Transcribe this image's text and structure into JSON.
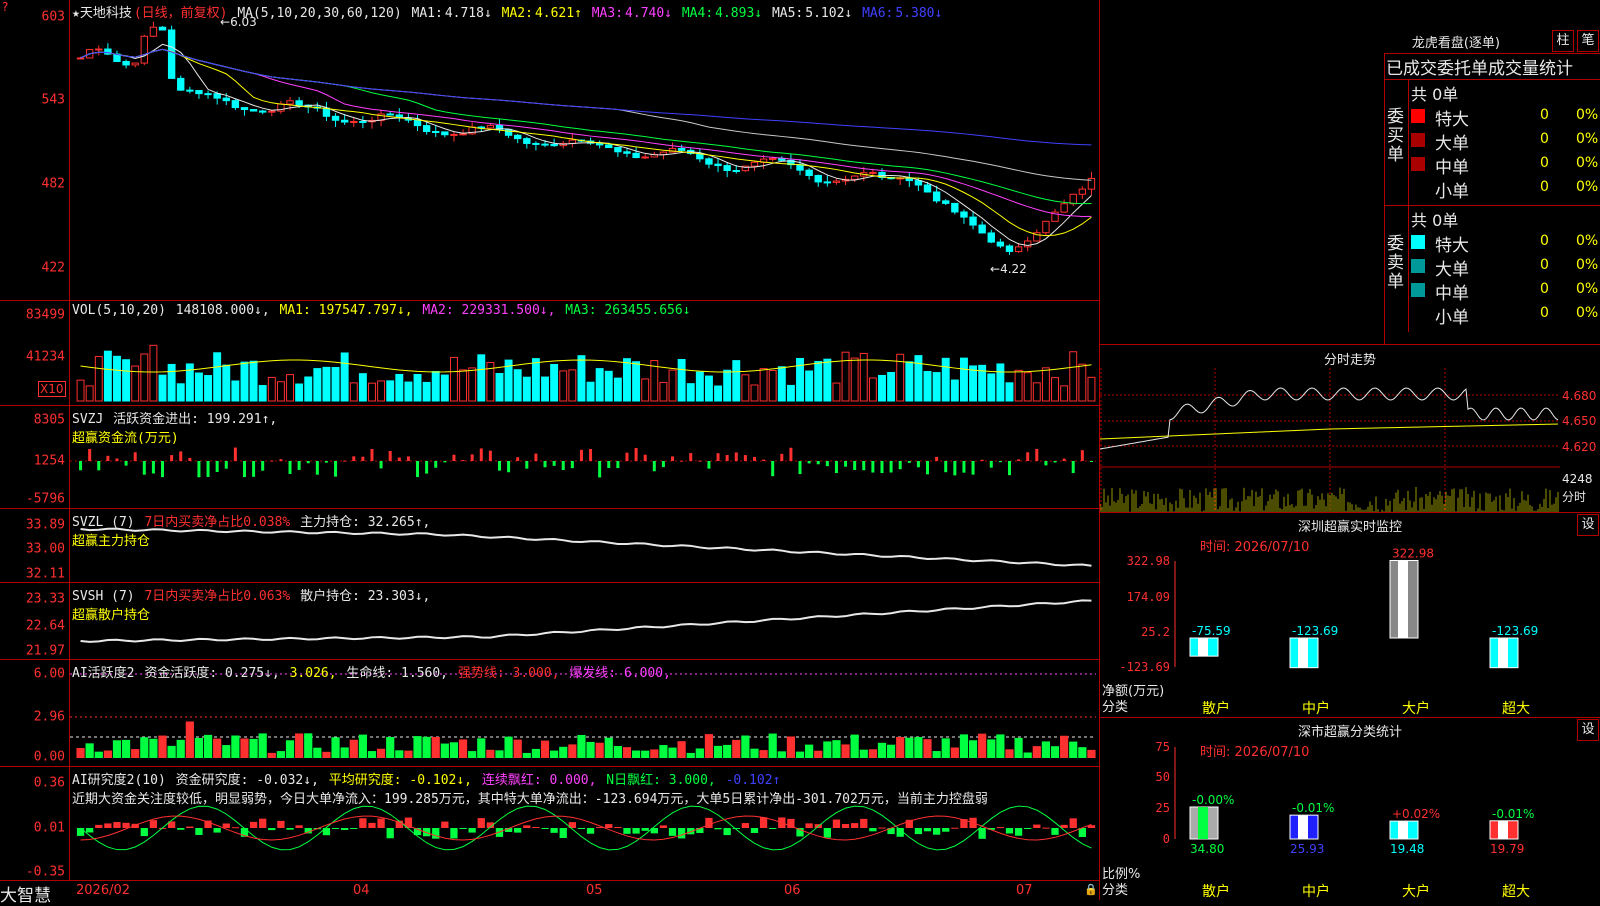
{
  "app": {
    "brand": "大智慧"
  },
  "main": {
    "stock_name": "★天地科技",
    "period": "(日线，前复权)",
    "ma_title": "MA(5,10,20,30,60,120)",
    "ma": [
      {
        "label": "MA1:",
        "value": "4.718↓",
        "color": "#e8e8e8"
      },
      {
        "label": "MA2:",
        "value": "4.621↑",
        "color": "#ffff00"
      },
      {
        "label": "MA3:",
        "value": "4.740↓",
        "color": "#ff40ff"
      },
      {
        "label": "MA4:",
        "value": "4.893↓",
        "color": "#00ff40"
      },
      {
        "label": "MA5:",
        "value": "5.102↓",
        "color": "#e8e8e8"
      },
      {
        "label": "MA6:",
        "value": "5.380↓",
        "color": "#4040ff"
      }
    ],
    "y_labels": [
      "603",
      "543",
      "482",
      "422"
    ],
    "high_marker": "6.03",
    "low_marker": "4.22"
  },
  "vol": {
    "title": "VOL(5,10,20)",
    "value": "148108.000↓,",
    "ma1": "MA1: 197547.797↓,",
    "ma2": "MA2: 229331.500↓,",
    "ma3": "MA3: 263455.656↓",
    "y_labels": [
      "83499",
      "41234"
    ],
    "unit": "X10"
  },
  "svzj": {
    "title": "SVZJ",
    "line1": "活跃资金进出: 199.291↑,",
    "line2": "超赢资金流(万元)",
    "y_labels": [
      "8305",
      "1254",
      "-5796"
    ]
  },
  "svzl": {
    "title": "SVZL (7)",
    "ratio": "7日内买卖净占比0.038%",
    "hold": "主力持仓: 32.265↑,",
    "line2": "超赢主力持仓",
    "y_labels": [
      "33.89",
      "33.00",
      "32.11"
    ]
  },
  "svsh": {
    "title": "SVSH (7)",
    "ratio": "7日内买卖净占比0.063%",
    "hold": "散户持仓: 23.303↓,",
    "line2": "超赢散户持仓",
    "y_labels": [
      "23.33",
      "22.64",
      "21.97"
    ]
  },
  "ai1": {
    "title": "AI活跃度2",
    "a": "资金活跃度: 0.275↓,",
    "b": "3.026,",
    "c": "生命线: 1.560,",
    "d": "强势线: 3.000,",
    "e": "爆发线: 6.000,",
    "y_labels": [
      "6.00",
      "2.96",
      "0.00"
    ]
  },
  "ai2": {
    "title": "AI研究度2(10)",
    "a": "资金研究度: -0.032↓,",
    "b": "平均研究度: -0.102↓,",
    "c": "连续飘红: 0.000,",
    "d": "N日飘红: 3.000,",
    "e": "-0.102↑",
    "text": "近期大资金关注度较低，明显弱势，今日大单净流入：199.285万元，其中特大单净流出：-123.694万元，大单5日累计净出-301.702万元，当前主力控盘弱",
    "y_labels": [
      "0.36",
      "0.01",
      "-0.35"
    ]
  },
  "xaxis": [
    "2026/02",
    "04",
    "05",
    "06",
    "07"
  ],
  "dragon": {
    "title": "龙虎看盘(逐单)",
    "btn1": "柱",
    "btn2": "笔",
    "header": "已成交委托单成交量统计",
    "buy_label": "委买单",
    "sell_label": "委卖单",
    "buy_total": "共 0单",
    "sell_total": "共 0单",
    "rows": [
      "特大",
      "大单",
      "中单",
      "小单"
    ],
    "zero": "0",
    "pct": "0%"
  },
  "intraday": {
    "title": "分时走势",
    "prices": [
      "4.680",
      "4.650",
      "4.620"
    ],
    "vol_label": "4248",
    "vol_sub": "分时"
  },
  "szmon": {
    "title": "深圳超赢实时监控",
    "btn": "设",
    "time": "时间: 2026/07/10",
    "y_labels": [
      "322.98",
      "174.09",
      "25.2",
      "-123.69"
    ],
    "ylabel1": "净额(万元)",
    "ylabel2": "分类",
    "categories": [
      "散户",
      "中户",
      "大户",
      "超大"
    ],
    "values": [
      "-75.59",
      "-123.69",
      "322.98",
      "-123.69"
    ]
  },
  "szcls": {
    "title": "深市超赢分类统计",
    "btn": "设",
    "time": "时间: 2026/07/10",
    "y_labels": [
      "75",
      "50",
      "25",
      "0"
    ],
    "ylabel1": "比例%",
    "ylabel2": "分类",
    "categories": [
      "散户",
      "中户",
      "大户",
      "超大"
    ],
    "changes": [
      "-0.00%",
      "-0.01%",
      "+0.02%",
      "-0.01%"
    ],
    "values": [
      "34.80",
      "25.93",
      "19.48",
      "19.79"
    ]
  },
  "colors": {
    "up": "#ff3030",
    "down": "#00ffff",
    "grid": "#b00000",
    "ma1": "#e8e8e8",
    "ma2": "#ffff00",
    "ma3": "#ff40ff",
    "ma4": "#00ff40",
    "ma6": "#4040ff"
  }
}
